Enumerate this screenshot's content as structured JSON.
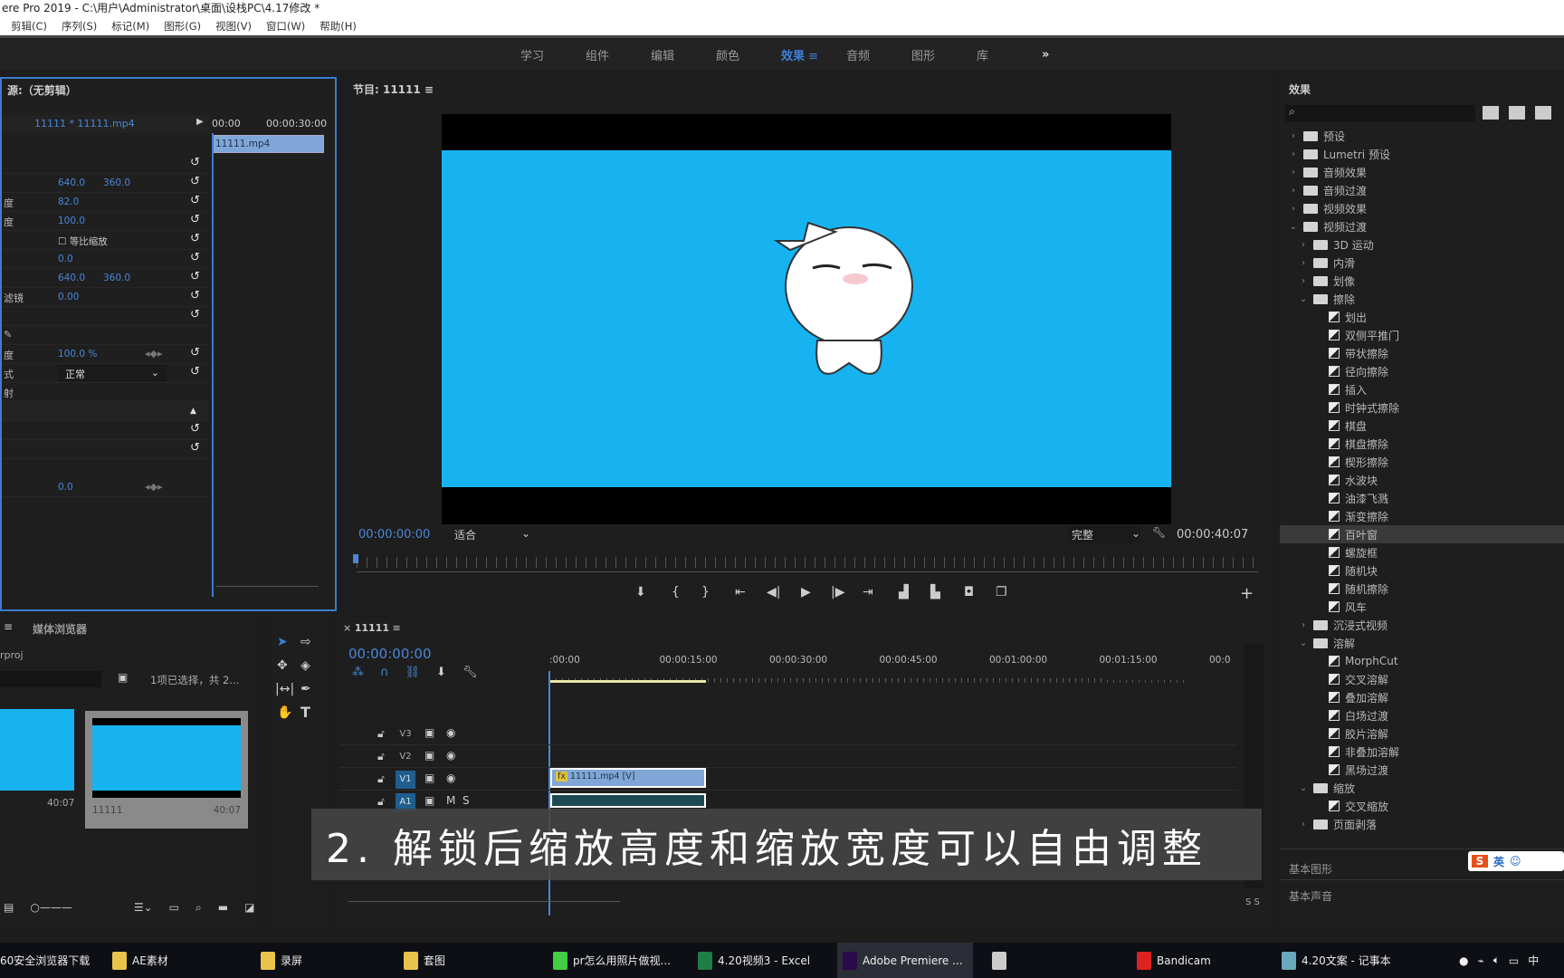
{
  "window": {
    "title": "ere Pro 2019 - C:\\用户\\Administrator\\桌面\\设栈PC\\4.17修改 *"
  },
  "menu": [
    "剪辑(C)",
    "序列(S)",
    "标记(M)",
    "图形(G)",
    "视图(V)",
    "窗口(W)",
    "帮助(H)"
  ],
  "workspaces": {
    "items": [
      "学习",
      "组件",
      "编辑",
      "颜色",
      "效果",
      "音频",
      "图形",
      "库"
    ],
    "active": "效果",
    "more": "»"
  },
  "source": {
    "title": "源:（无剪辑）",
    "clip_selector": "11111 * 11111.mp4",
    "time_start": "00:00",
    "time_end": "00:00:30:00",
    "clip": "11111.mp4",
    "rows": [
      {
        "label": "",
        "v1": "",
        "v2": ""
      },
      {
        "label": "",
        "v1": "640.0",
        "v2": "360.0"
      },
      {
        "label": "度",
        "v1": "82.0",
        "v2": ""
      },
      {
        "label": "度",
        "v1": "100.0",
        "v2": ""
      },
      {
        "label": "",
        "v1": "",
        "v2": ""
      },
      {
        "label": "",
        "v1": "0.0",
        "v2": ""
      },
      {
        "label": "",
        "v1": "640.0",
        "v2": "360.0"
      },
      {
        "label": "滤镜",
        "v1": "0.00",
        "v2": ""
      },
      {
        "label": "",
        "v1": "",
        "v2": ""
      }
    ],
    "uniform_scale": "等比缩放",
    "opacity_label": "度",
    "opacity": "100.0 %",
    "blend_label": "式",
    "blend_mode": "正常",
    "map_label": "射",
    "last_value": "0.0"
  },
  "program": {
    "title": "节目: 11111",
    "timecode": "00:00:00:00",
    "fit": "适合",
    "quality": "完整",
    "duration": "00:00:40:07"
  },
  "effects": {
    "title": "效果",
    "search_placeholder": "",
    "tree": [
      {
        "label": "预设",
        "level": 0,
        "type": "folder",
        "state": "closed"
      },
      {
        "label": "Lumetri 预设",
        "level": 0,
        "type": "folder",
        "state": "closed"
      },
      {
        "label": "音频效果",
        "level": 0,
        "type": "folder",
        "state": "closed"
      },
      {
        "label": "音频过渡",
        "level": 0,
        "type": "folder",
        "state": "closed"
      },
      {
        "label": "视频效果",
        "level": 0,
        "type": "folder",
        "state": "closed"
      },
      {
        "label": "视频过渡",
        "level": 0,
        "type": "folder",
        "state": "open"
      },
      {
        "label": "3D 运动",
        "level": 1,
        "type": "folder",
        "state": "closed"
      },
      {
        "label": "内滑",
        "level": 1,
        "type": "folder",
        "state": "closed"
      },
      {
        "label": "划像",
        "level": 1,
        "type": "folder",
        "state": "closed"
      },
      {
        "label": "擦除",
        "level": 1,
        "type": "folder",
        "state": "open"
      },
      {
        "label": "划出",
        "level": 2,
        "type": "item"
      },
      {
        "label": "双侧平推门",
        "level": 2,
        "type": "item"
      },
      {
        "label": "带状擦除",
        "level": 2,
        "type": "item"
      },
      {
        "label": "径向擦除",
        "level": 2,
        "type": "item"
      },
      {
        "label": "插入",
        "level": 2,
        "type": "item"
      },
      {
        "label": "时钟式擦除",
        "level": 2,
        "type": "item"
      },
      {
        "label": "棋盘",
        "level": 2,
        "type": "item"
      },
      {
        "label": "棋盘擦除",
        "level": 2,
        "type": "item"
      },
      {
        "label": "楔形擦除",
        "level": 2,
        "type": "item"
      },
      {
        "label": "水波块",
        "level": 2,
        "type": "item"
      },
      {
        "label": "油漆飞溅",
        "level": 2,
        "type": "item"
      },
      {
        "label": "渐变擦除",
        "level": 2,
        "type": "item"
      },
      {
        "label": "百叶窗",
        "level": 2,
        "type": "item",
        "selected": true
      },
      {
        "label": "螺旋框",
        "level": 2,
        "type": "item"
      },
      {
        "label": "随机块",
        "level": 2,
        "type": "item"
      },
      {
        "label": "随机擦除",
        "level": 2,
        "type": "item"
      },
      {
        "label": "风车",
        "level": 2,
        "type": "item"
      },
      {
        "label": "沉浸式视频",
        "level": 1,
        "type": "folder",
        "state": "closed"
      },
      {
        "label": "溶解",
        "level": 1,
        "type": "folder",
        "state": "open"
      },
      {
        "label": "MorphCut",
        "level": 2,
        "type": "item"
      },
      {
        "label": "交叉溶解",
        "level": 2,
        "type": "item"
      },
      {
        "label": "叠加溶解",
        "level": 2,
        "type": "item"
      },
      {
        "label": "白场过渡",
        "level": 2,
        "type": "item"
      },
      {
        "label": "胶片溶解",
        "level": 2,
        "type": "item"
      },
      {
        "label": "非叠加溶解",
        "level": 2,
        "type": "item"
      },
      {
        "label": "黑场过渡",
        "level": 2,
        "type": "item"
      },
      {
        "label": "缩放",
        "level": 1,
        "type": "folder",
        "state": "open"
      },
      {
        "label": "交叉缩放",
        "level": 2,
        "type": "item"
      },
      {
        "label": "页面剥落",
        "level": 1,
        "type": "folder",
        "state": "closed"
      }
    ],
    "sections": [
      "基本图形",
      "基本声音"
    ]
  },
  "ime": {
    "label": "英"
  },
  "project": {
    "tab": "媒体浏览器",
    "path": "rproj",
    "status": "1项已选择，共 2...",
    "items": [
      {
        "name": "",
        "duration": "40:07"
      },
      {
        "name": "11111",
        "duration": "40:07"
      }
    ]
  },
  "timeline": {
    "tab": "11111",
    "timecode": "00:00:00:00",
    "ruler": [
      ":00:00",
      "00:00:15:00",
      "00:00:30:00",
      "00:00:45:00",
      "00:01:00:00",
      "00:01:15:00",
      "00:0"
    ],
    "tracks": [
      {
        "name": "V3"
      },
      {
        "name": "V2"
      },
      {
        "name": "V1"
      },
      {
        "name": "A1"
      }
    ],
    "clip": "11111.mp4 [V]",
    "meter_label": "S S"
  },
  "subtitle": "2. 解锁后缩放高度和缩放宽度可以自由调整",
  "taskbar": {
    "items": [
      "60安全浏览器下载",
      "AE素材",
      "录屏",
      "套图",
      "pr怎么用照片做视...",
      "4.20视频3 - Excel",
      "Adobe Premiere ...",
      "",
      "Bandicam",
      "4.20文案 - 记事本"
    ],
    "active": "Adobe Premiere ..."
  },
  "colors": {
    "accent": "#3e7fd6",
    "video_bg": "#17b3f1",
    "clip": "#7fa6d6"
  }
}
